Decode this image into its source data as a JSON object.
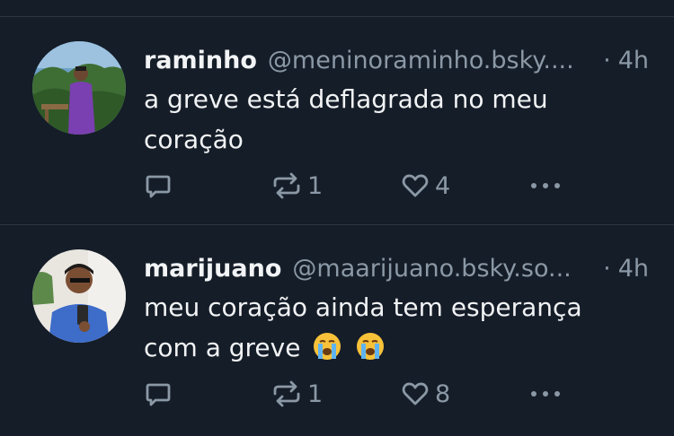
{
  "posts": [
    {
      "author": {
        "name": "raminho",
        "handle": "@meninoraminho.bsky...."
      },
      "time": "4h",
      "text_lines": [
        "a greve está deflagrada no meu",
        "coração"
      ],
      "emojis": [],
      "counts": {
        "reposts": "1",
        "likes": "4"
      }
    },
    {
      "author": {
        "name": "marijuano",
        "handle": "@maarijuano.bsky.so..."
      },
      "time": "4h",
      "text_lines": [
        "meu coração ainda tem esperança",
        "com a greve"
      ],
      "emojis": [
        "😭",
        "😭"
      ],
      "counts": {
        "reposts": "1",
        "likes": "8"
      }
    }
  ],
  "separator": "·",
  "icons": {
    "reply": "speech-bubble-icon",
    "repost": "repost-arrows-icon",
    "like": "heart-icon",
    "more": "ellipsis-icon"
  },
  "colors": {
    "background": "#151d28",
    "text": "#f1f3f5",
    "muted": "#8b98a6",
    "divider": "#2c3744"
  }
}
